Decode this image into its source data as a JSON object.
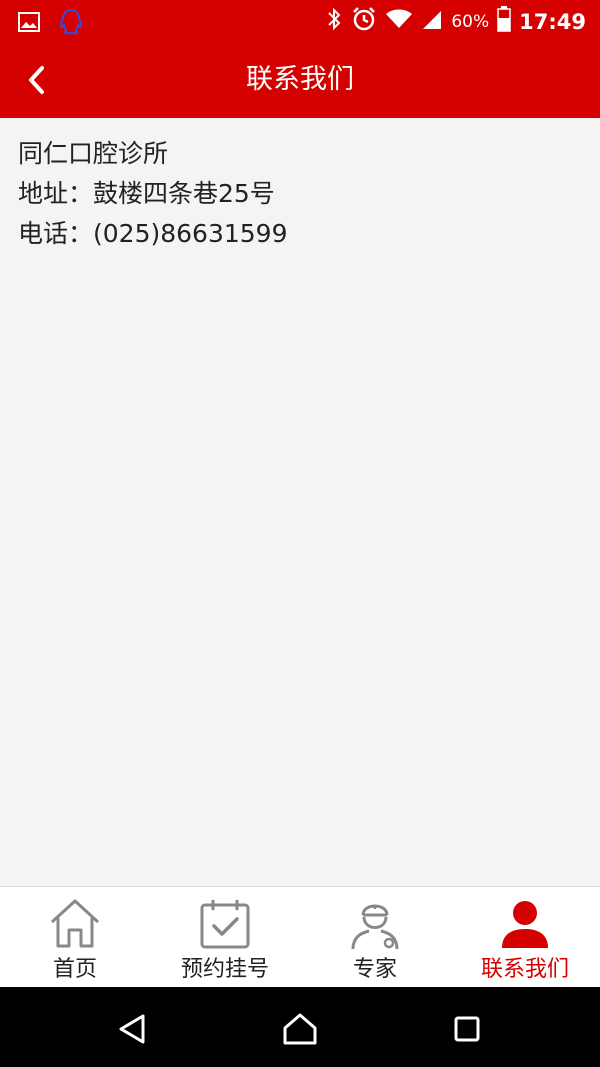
{
  "status_bar": {
    "battery_text": "60%",
    "time": "17:49",
    "icons": [
      "image-icon",
      "qq-icon",
      "bluetooth-icon",
      "alarm-icon",
      "wifi-icon",
      "signal-icon",
      "battery-icon"
    ]
  },
  "app_bar": {
    "title": "联系我们",
    "back_icon": "back-chevron-icon"
  },
  "content": {
    "clinic_name": "同仁口腔诊所",
    "address": "地址：鼓楼四条巷25号",
    "phone": "电话：(025)86631599"
  },
  "tabs": [
    {
      "label": "首页",
      "icon": "home-icon",
      "active": false
    },
    {
      "label": "预约挂号",
      "icon": "calendar-check-icon",
      "active": false
    },
    {
      "label": "专家",
      "icon": "doctor-icon",
      "active": false
    },
    {
      "label": "联系我们",
      "icon": "person-icon",
      "active": true
    }
  ],
  "colors": {
    "brand": "#d50000",
    "tab_inactive": "#222222",
    "icon_gray": "#888888"
  },
  "nav_bar": {
    "icons": [
      "back-triangle-icon",
      "home-outline-icon",
      "recents-square-icon"
    ]
  }
}
